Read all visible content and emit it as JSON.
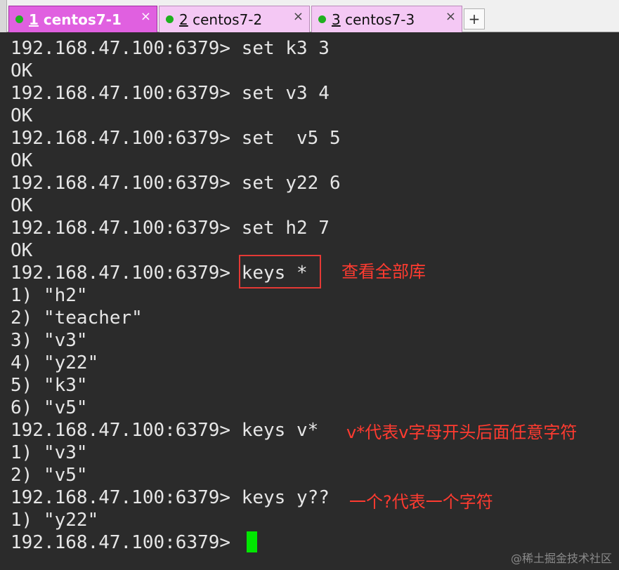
{
  "tabs": [
    {
      "number": "1",
      "name": " centos7-1",
      "close": "×",
      "status_color": "#1fb01f"
    },
    {
      "number": "2",
      "name": " centos7-2",
      "close": "×",
      "status_color": "#1fb01f"
    },
    {
      "number": "3",
      "name": " centos7-3",
      "close": "×",
      "status_color": "#1fb01f"
    }
  ],
  "new_tab_label": "+",
  "terminal": {
    "lines": [
      "192.168.47.100:6379> set k3 3",
      "OK",
      "192.168.47.100:6379> set v3 4",
      "OK",
      "192.168.47.100:6379> set  v5 5",
      "OK",
      "192.168.47.100:6379> set y22 6",
      "OK",
      "192.168.47.100:6379> set h2 7",
      "OK",
      "192.168.47.100:6379> keys *",
      "1) \"h2\"",
      "2) \"teacher\"",
      "3) \"v3\"",
      "4) \"y22\"",
      "5) \"k3\"",
      "6) \"v5\"",
      "192.168.47.100:6379> keys v*",
      "1) \"v3\"",
      "2) \"v5\"",
      "192.168.47.100:6379> keys y??",
      "1) \"y22\"",
      "192.168.47.100:6379> "
    ],
    "cursor_color": "#00e600"
  },
  "annotations": {
    "keys_all": "查看全部库",
    "keys_v": "v*代表v字母开头后面任意字符",
    "keys_y": "一个?代表一个字符",
    "color": "#ff3b30"
  },
  "watermark": "@稀土掘金技术社区"
}
